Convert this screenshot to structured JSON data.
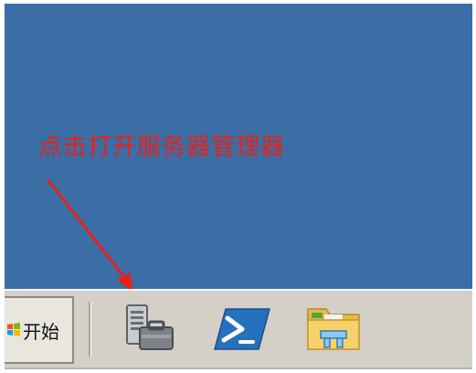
{
  "annotation": {
    "text": "点击打开服务器管理器",
    "color": "#e8201a"
  },
  "desktop": {
    "background_color": "#3a6ea5"
  },
  "taskbar": {
    "start_label": "开始",
    "pinned_items": [
      {
        "icon": "server-manager-icon"
      },
      {
        "icon": "powershell-icon"
      },
      {
        "icon": "windows-explorer-icon"
      }
    ]
  }
}
